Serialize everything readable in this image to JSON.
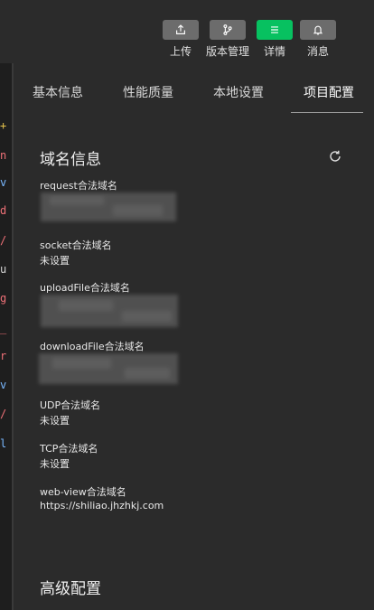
{
  "toolbar": {
    "items": [
      {
        "label": "上传",
        "icon": "upload-icon",
        "active": false
      },
      {
        "label": "版本管理",
        "icon": "branch-icon",
        "active": false
      },
      {
        "label": "详情",
        "icon": "menu-icon",
        "active": true
      },
      {
        "label": "消息",
        "icon": "bell-icon",
        "active": false
      }
    ],
    "colors": {
      "button": "#6c6c6c",
      "active": "#07c160"
    }
  },
  "tabs": [
    {
      "label": "基本信息"
    },
    {
      "label": "性能质量"
    },
    {
      "label": "本地设置"
    },
    {
      "label": "项目配置",
      "active": true
    }
  ],
  "domain_section": {
    "title": "域名信息",
    "fields": [
      {
        "label": "request合法域名",
        "value": ""
      },
      {
        "label": "socket合法域名",
        "value": "未设置"
      },
      {
        "label": "uploadFile合法域名",
        "value": ""
      },
      {
        "label": "downloadFile合法域名",
        "value": ""
      },
      {
        "label": "UDP合法域名",
        "value": "未设置"
      },
      {
        "label": "TCP合法域名",
        "value": "未设置"
      },
      {
        "label": "web-view合法域名",
        "value": "https://shiliao.jhzhkj.com"
      }
    ]
  },
  "advanced_section": {
    "title": "高级配置"
  },
  "editor_strip": [
    {
      "text": "+",
      "color": "#e6c34c"
    },
    {
      "text": "n",
      "color": "#f07178"
    },
    {
      "text": "v",
      "color": "#79b8ff"
    },
    {
      "text": "d",
      "color": "#f07178"
    },
    {
      "text": "/",
      "color": "#f07178"
    },
    {
      "text": "u",
      "color": "#d4d4d4"
    },
    {
      "text": "g",
      "color": "#f07178"
    },
    {
      "text": "_",
      "color": "#f07178"
    },
    {
      "text": "r",
      "color": "#f07178"
    },
    {
      "text": "v",
      "color": "#79b8ff"
    },
    {
      "text": "/",
      "color": "#f07178"
    },
    {
      "text": "l",
      "color": "#79b8ff"
    }
  ]
}
